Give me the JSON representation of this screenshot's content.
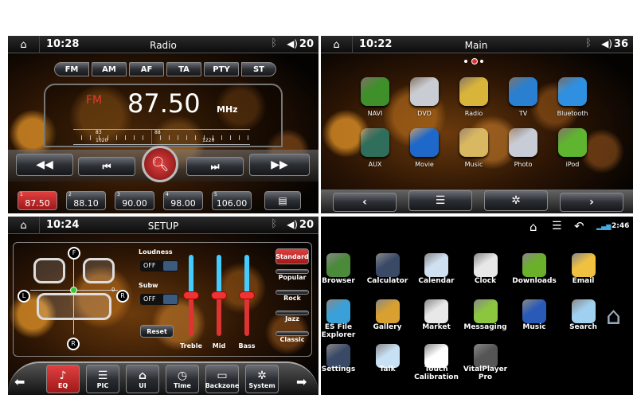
{
  "radio": {
    "time": "10:28",
    "title": "Radio",
    "volume": "20",
    "modes": [
      "FM",
      "AM",
      "AF",
      "TA",
      "PTY",
      "ST"
    ],
    "band": "FM",
    "frequency": "87.50",
    "unit": "MHz",
    "dial_top": [
      "83",
      "88"
    ],
    "dial_bottom": [
      "1020",
      "1220"
    ],
    "presets": [
      {
        "n": "1",
        "f": "87.50",
        "active": true
      },
      {
        "n": "2",
        "f": "88.10"
      },
      {
        "n": "3",
        "f": "90.00"
      },
      {
        "n": "4",
        "f": "98.00"
      },
      {
        "n": "5",
        "f": "106.00"
      }
    ],
    "controls": [
      "rewind-icon",
      "prev-track-icon",
      "search-icon",
      "next-track-icon",
      "fast-forward-icon"
    ],
    "accent": "#c0282a"
  },
  "main": {
    "time": "10:22",
    "title": "Main",
    "volume": "36",
    "page_dots": 3,
    "active_page": 2,
    "apps": [
      {
        "label": "NAVI",
        "color": "#3f8f2a"
      },
      {
        "label": "DVD",
        "color": "#c9ccd2"
      },
      {
        "label": "Radio",
        "color": "#d9b43a"
      },
      {
        "label": "TV",
        "color": "#2a7fd0"
      },
      {
        "label": "Bluetooth",
        "color": "#2f8fe0"
      },
      {
        "label": "AUX",
        "color": "#2f6e5a"
      },
      {
        "label": "Movie",
        "color": "#1d68c8"
      },
      {
        "label": "Music",
        "color": "#d8b860"
      },
      {
        "label": "Photo",
        "color": "#c8ccd6"
      },
      {
        "label": "iPod",
        "color": "#5fb530"
      }
    ]
  },
  "setup": {
    "time": "10:24",
    "title": "SETUP",
    "volume": "20",
    "balance_labels": {
      "front": "F",
      "left": "L",
      "right": "R",
      "rear": "R",
      "zero": "0"
    },
    "loudness": {
      "label": "Loudness",
      "state": "OFF"
    },
    "subw": {
      "label": "Subw",
      "state": "OFF"
    },
    "reset": "Reset",
    "sliders": [
      {
        "label": "Treble",
        "level": 0.5
      },
      {
        "label": "Mid",
        "level": 0.5
      },
      {
        "label": "Bass",
        "level": 0.5
      }
    ],
    "presets": [
      {
        "label": "Standard",
        "active": true
      },
      {
        "label": "Popular"
      },
      {
        "label": "Rock"
      },
      {
        "label": "Jazz"
      },
      {
        "label": "Classic"
      }
    ],
    "tabs": [
      {
        "label": "EQ",
        "active": true
      },
      {
        "label": "PIC"
      },
      {
        "label": "UI"
      },
      {
        "label": "Time"
      },
      {
        "label": "Backzone"
      },
      {
        "label": "System"
      }
    ]
  },
  "android": {
    "time": "2:46",
    "apps": [
      {
        "label": "Browser",
        "color": "#4a8a3a"
      },
      {
        "label": "Calculator",
        "color": "#3a4a66"
      },
      {
        "label": "Calendar",
        "color": "#cfe0f0"
      },
      {
        "label": "Clock",
        "color": "#e8e8e8"
      },
      {
        "label": "Downloads",
        "color": "#6ab02a"
      },
      {
        "label": "Email",
        "color": "#f0c040"
      },
      {
        "label": "ES File Explorer",
        "color": "#3aa0d8"
      },
      {
        "label": "Gallery",
        "color": "#d8a030"
      },
      {
        "label": "Market",
        "color": "#e8e8e8"
      },
      {
        "label": "Messaging",
        "color": "#8cc63f"
      },
      {
        "label": "Music",
        "color": "#2a5ab8"
      },
      {
        "label": "Search",
        "color": "#9fd0f0"
      },
      {
        "label": "Settings",
        "color": "#3a4a66"
      },
      {
        "label": "Talk",
        "color": "#c8e0f4"
      },
      {
        "label": "Touch Calibration",
        "color": "#ffffff"
      },
      {
        "label": "VitalPlayer Pro",
        "color": "#555555"
      }
    ]
  }
}
